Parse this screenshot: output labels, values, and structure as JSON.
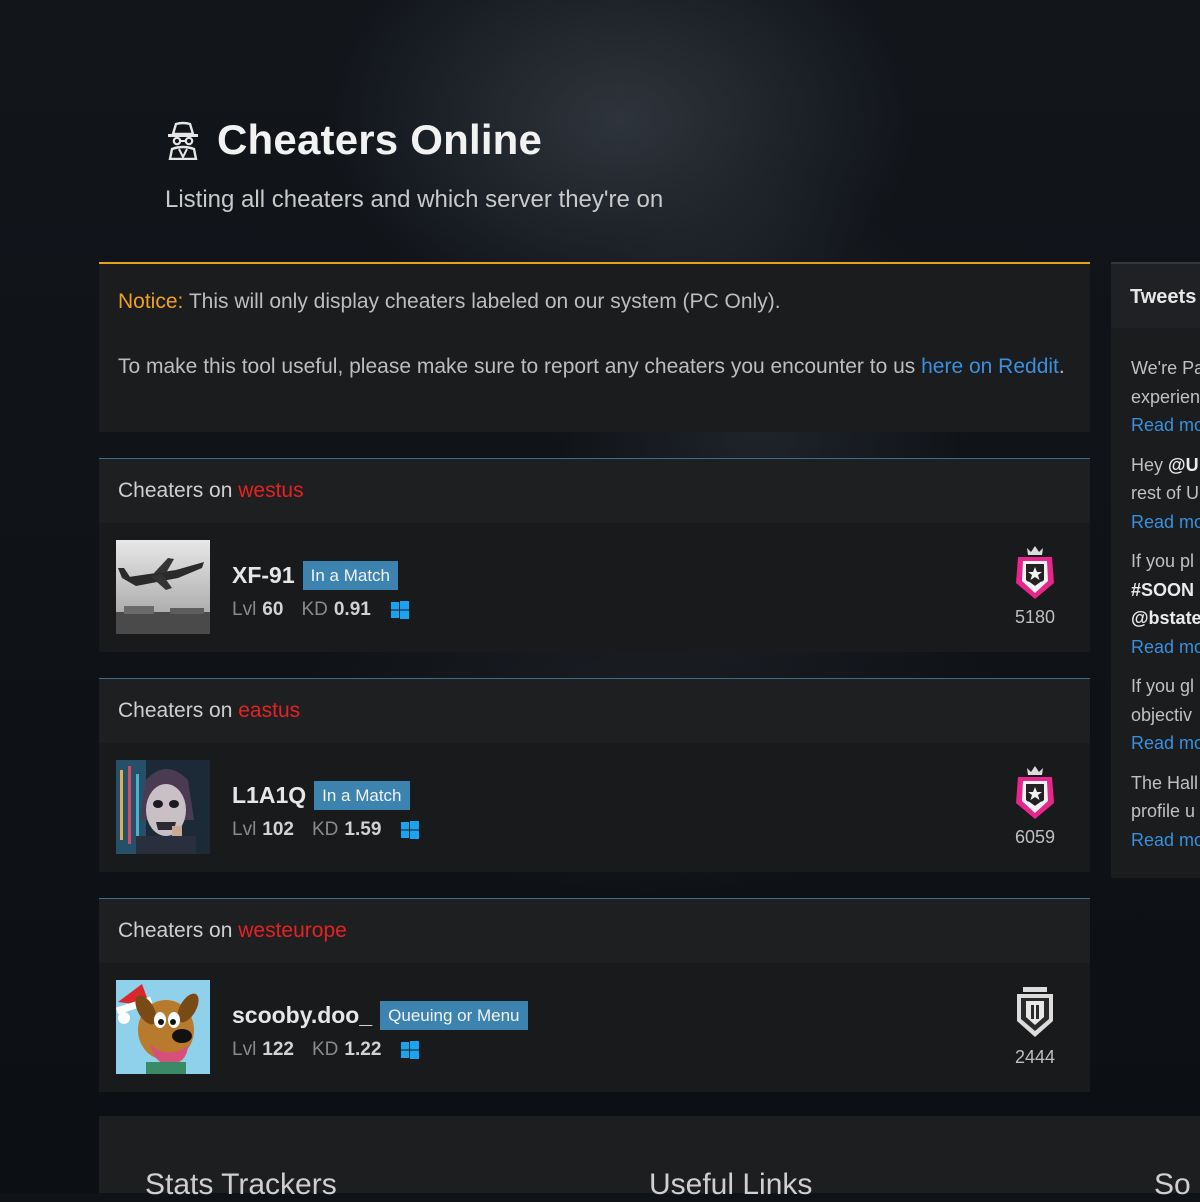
{
  "header": {
    "title": "Cheaters Online",
    "subtitle": "Listing all cheaters and which server they're on"
  },
  "notice": {
    "label": "Notice:",
    "text": " This will only display cheaters labeled on our system (PC Only).",
    "report_text": "To make this tool useful, please make sure to report any cheaters you encounter to us ",
    "report_link": "here on Reddit",
    "period": "."
  },
  "servers": [
    {
      "prefix": "Cheaters on ",
      "name": "westus",
      "player": {
        "name": "XF-91",
        "status": "In a Match",
        "lvl_label": "Lvl",
        "lvl": "60",
        "kd_label": "KD",
        "kd": "0.91",
        "mmr": "5180",
        "rank_icon": "champion-rank-icon",
        "avatar": "jet-plane-avatar"
      }
    },
    {
      "prefix": "Cheaters on ",
      "name": "eastus",
      "player": {
        "name": "L1A1Q",
        "status": "In a Match",
        "lvl_label": "Lvl",
        "lvl": "102",
        "kd_label": "KD",
        "kd": "1.59",
        "mmr": "6059",
        "rank_icon": "champion-rank-icon",
        "avatar": "masked-face-avatar"
      }
    },
    {
      "prefix": "Cheaters on ",
      "name": "westeurope",
      "player": {
        "name": "scooby.doo_",
        "status": "Queuing or Menu",
        "lvl_label": "Lvl",
        "lvl": "122",
        "kd_label": "KD",
        "kd": "1.22",
        "mmr": "2444",
        "rank_icon": "silver-rank-icon",
        "avatar": "scooby-doo-avatar"
      }
    }
  ],
  "tweets": {
    "title": "Tweets",
    "items": [
      {
        "lines": [
          "We're Pa",
          "experien"
        ],
        "more": "Read mo"
      },
      {
        "lines": [
          "Hey @U",
          "rest of U"
        ],
        "more": "Read mo"
      },
      {
        "lines": [
          "If you pl",
          "#SOON",
          "@bstate"
        ],
        "more": "Read mo"
      },
      {
        "lines": [
          "If you gl",
          "objectiv"
        ],
        "more": "Read mo"
      },
      {
        "lines": [
          "The Hall",
          "profile u"
        ],
        "more": "Read mo"
      }
    ]
  },
  "footer": {
    "col1": "Stats Trackers",
    "col2": "Useful Links",
    "col3": "So"
  },
  "colors": {
    "accent_notice": "#e6a21b",
    "server_name": "#e52222",
    "link": "#3a8fde",
    "badge": "#3c83b0",
    "windows": "#1aa3f0",
    "champion": "#e6268c"
  }
}
